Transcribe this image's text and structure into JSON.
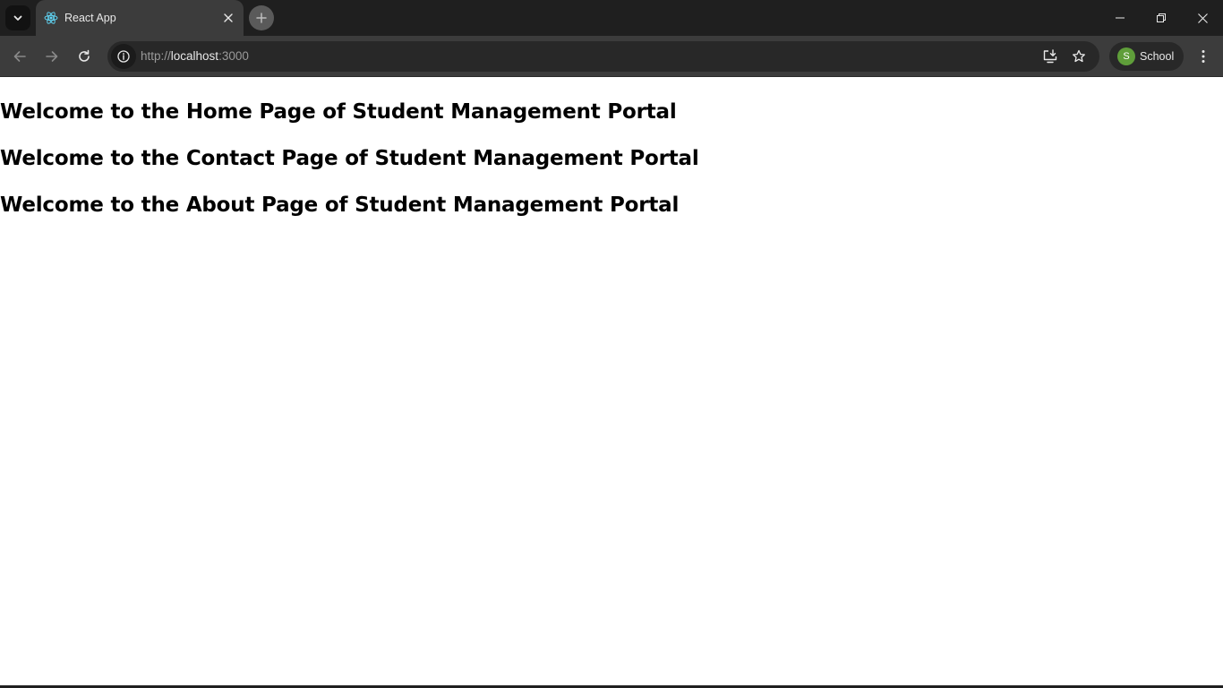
{
  "browser": {
    "tab": {
      "title": "React App",
      "favicon": "react-logo-icon"
    },
    "address_bar": {
      "scheme": "http://",
      "host": "localhost",
      "port": ":3000"
    },
    "profile": {
      "initial": "S",
      "name": "School",
      "avatar_color": "#5f9e3a"
    },
    "icons": {
      "tab_search": "chevron-down-icon",
      "tab_close": "close-icon",
      "new_tab": "plus-icon",
      "back": "arrow-left-icon",
      "forward": "arrow-right-icon",
      "reload": "reload-icon",
      "site_info": "info-icon",
      "install": "install-app-icon",
      "bookmark": "star-icon",
      "menu": "kebab-menu-icon",
      "minimize": "minimize-icon",
      "restore": "restore-icon",
      "close_window": "close-icon"
    },
    "theme": {
      "titlebar": "#1f1f1f",
      "toolbar": "#3c3c3c",
      "omnibox": "#282828"
    }
  },
  "page": {
    "headings": {
      "home": "Welcome to the Home Page of Student Management Portal",
      "contact": "Welcome to the Contact Page of Student Management Portal",
      "about": "Welcome to the About Page of Student Management Portal"
    }
  }
}
